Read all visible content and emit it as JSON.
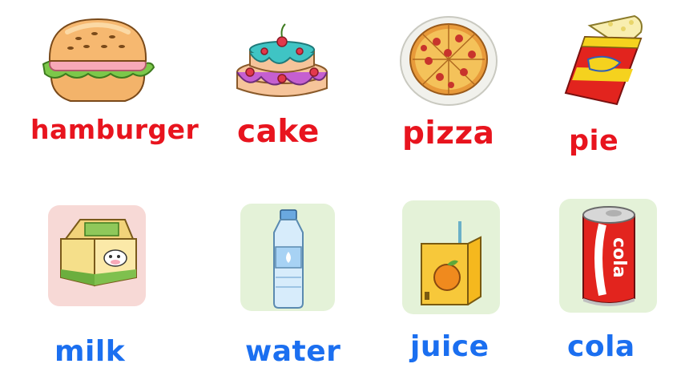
{
  "foods": [
    {
      "id": "hamburger",
      "label": "hamburger",
      "icon": "hamburger-icon"
    },
    {
      "id": "cake",
      "label": "cake",
      "icon": "cake-icon"
    },
    {
      "id": "pizza",
      "label": "pizza",
      "icon": "pizza-icon"
    },
    {
      "id": "pie",
      "label": "pie",
      "icon": "pie-icon"
    }
  ],
  "drinks": [
    {
      "id": "milk",
      "label": "milk",
      "icon": "milk-carton-icon"
    },
    {
      "id": "water",
      "label": "water",
      "icon": "water-bottle-icon"
    },
    {
      "id": "juice",
      "label": "juice",
      "icon": "juice-box-icon"
    },
    {
      "id": "cola",
      "label": "cola",
      "icon": "cola-can-icon",
      "can_text": "cola"
    }
  ],
  "colors": {
    "food_label": "#e8141e",
    "drink_label": "#1b6ff0",
    "card_green": "#e4f2d8",
    "card_pink": "#f7d9d6"
  }
}
